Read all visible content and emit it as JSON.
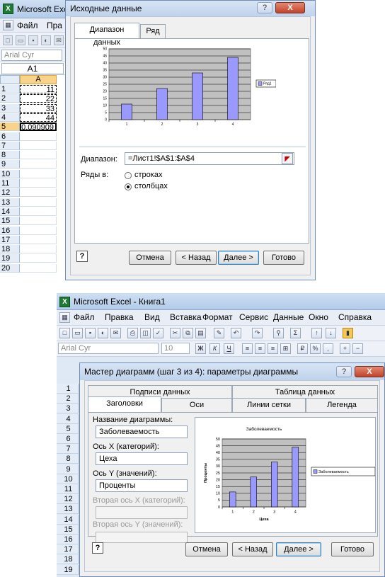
{
  "shot1": {
    "app_title": "Microsoft Excel",
    "menu": [
      "Файл",
      "Пра"
    ],
    "font_name": "Arial Cyr",
    "name_box": "A1",
    "column_a": "A",
    "rows": [
      "1",
      "2",
      "3",
      "4",
      "5",
      "6",
      "7",
      "8",
      "9",
      "10",
      "11",
      "12",
      "13",
      "14",
      "15",
      "16",
      "17",
      "18",
      "19",
      "20"
    ],
    "cells": [
      "11",
      "22",
      "33",
      "44",
      "0.090909"
    ],
    "dialog": {
      "title": "Исходные данные",
      "help": "?",
      "close": "X",
      "tabs": [
        "Диапазон данных",
        "Ряд"
      ],
      "range_label": "Диапазон:",
      "range_value": "=Лист1!$A$1:$A$4",
      "series_in_label": "Ряды в:",
      "series_rows": "строках",
      "series_cols": "столбцах",
      "help_btn": "?",
      "buttons": [
        "Отмена",
        "< Назад",
        "Далее >",
        "Готово"
      ]
    }
  },
  "shot2": {
    "app_title": "Microsoft Excel - Книга1",
    "menu": [
      "Файл",
      "Правка",
      "Вид",
      "Вставка",
      "Формат",
      "Сервис",
      "Данные",
      "Окно",
      "Справка"
    ],
    "font_name": "Arial Cyr",
    "font_size": "10",
    "format_buttons": [
      "Ж",
      "К",
      "Ч"
    ],
    "rows": [
      "1",
      "2",
      "3",
      "4",
      "5",
      "6",
      "7",
      "8",
      "9",
      "10",
      "11",
      "12",
      "13",
      "14",
      "15",
      "16",
      "17",
      "18",
      "19"
    ],
    "dialog": {
      "title": "Мастер диаграмм (шаг 3 из 4): параметры диаграммы",
      "help": "?",
      "close": "X",
      "tabs_back": [
        "Подписи данных",
        "Таблица данных"
      ],
      "tabs_front": [
        "Заголовки",
        "Оси",
        "Линии сетки",
        "Легенда"
      ],
      "title_label": "Название диаграммы:",
      "title_value": "Заболеваемость",
      "xaxis_label": "Ось X (категорий):",
      "xaxis_value": "Цеха",
      "yaxis_label": "Ось Y (значений):",
      "yaxis_value": "Проценты",
      "x2_label": "Вторая ось X (категорий):",
      "y2_label": "Вторая ось Y (значений):",
      "help_btn": "?",
      "buttons": [
        "Отмена",
        "< Назад",
        "Далее >",
        "Готово"
      ]
    }
  },
  "chart_data": [
    {
      "type": "bar",
      "categories": [
        "1",
        "2",
        "3",
        "4"
      ],
      "series": [
        {
          "name": "Ряд1",
          "values": [
            11,
            22,
            33,
            44
          ]
        }
      ],
      "yticks": [
        "0",
        "5",
        "10",
        "15",
        "20",
        "25",
        "30",
        "35",
        "40",
        "45",
        "50"
      ],
      "ylim": [
        0,
        50
      ],
      "title": "",
      "xlabel": "",
      "ylabel": "",
      "grid": true,
      "legend": "right",
      "bar_color": "#9999ff",
      "plot_bg": "#c0c0c0"
    },
    {
      "type": "bar",
      "categories": [
        "1",
        "2",
        "3",
        "4"
      ],
      "series": [
        {
          "name": "Заболеваемость",
          "values": [
            11,
            22,
            33,
            44
          ]
        }
      ],
      "yticks": [
        "0",
        "5",
        "10",
        "15",
        "20",
        "25",
        "30",
        "35",
        "40",
        "45",
        "50"
      ],
      "ylim": [
        0,
        50
      ],
      "title": "Заболеваемость",
      "xlabel": "Цеха",
      "ylabel": "Проценты",
      "grid": true,
      "legend": "right",
      "bar_color": "#9999ff",
      "plot_bg": "#c0c0c0"
    }
  ]
}
